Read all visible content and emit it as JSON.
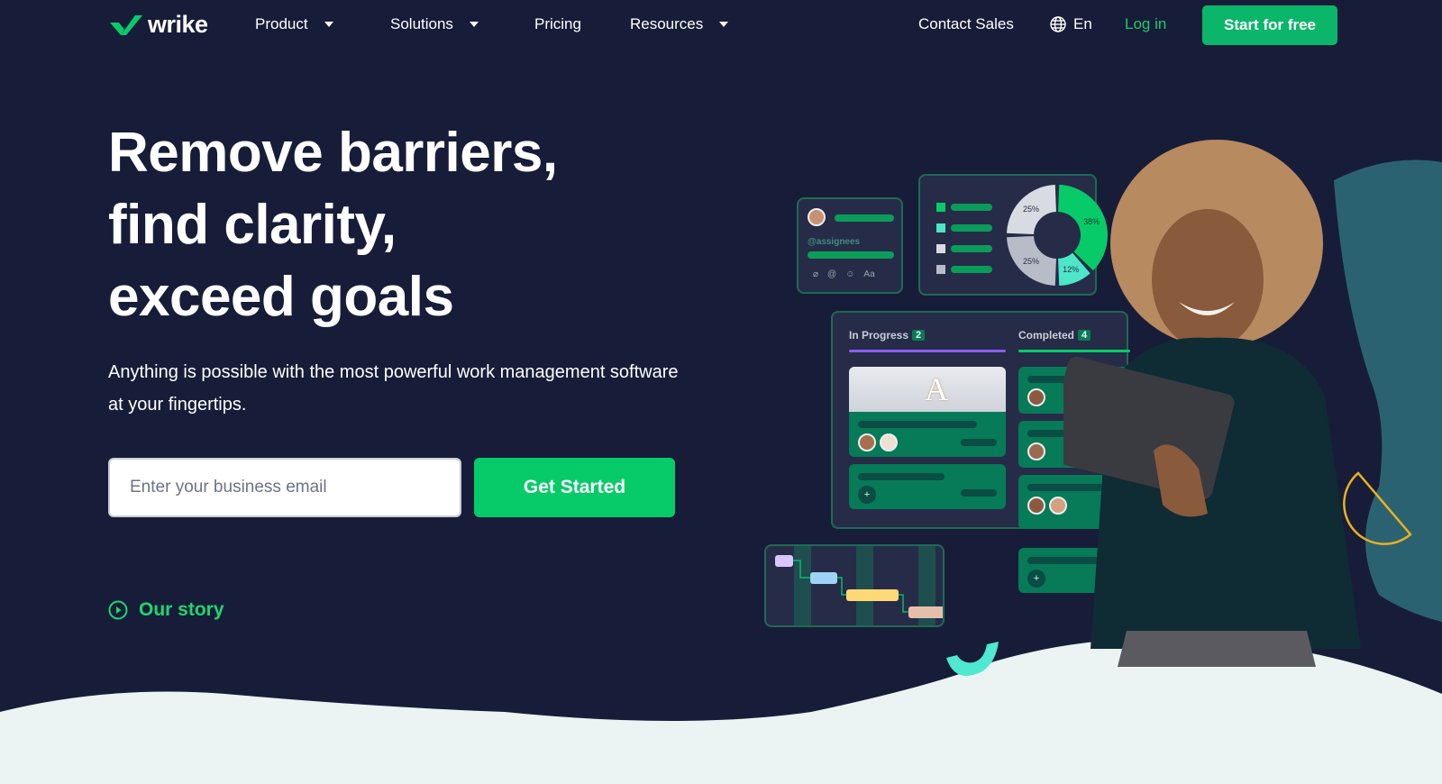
{
  "brand": {
    "name": "wrike",
    "accent": "#07cb69",
    "background": "#171d38"
  },
  "nav": {
    "items": [
      {
        "label": "Product",
        "has_dropdown": true
      },
      {
        "label": "Solutions",
        "has_dropdown": true
      },
      {
        "label": "Pricing",
        "has_dropdown": false
      },
      {
        "label": "Resources",
        "has_dropdown": true
      }
    ],
    "contact_sales": "Contact Sales",
    "language": "En",
    "login": "Log in",
    "cta": "Start for free"
  },
  "hero": {
    "headline_lines": [
      "Remove barriers,",
      "find clarity,",
      "exceed goals"
    ],
    "subtitle": "Anything is possible with the most powerful work management software at your fingertips.",
    "email_placeholder": "Enter your business email",
    "email_value": "",
    "cta": "Get Started",
    "story_link": "Our story"
  },
  "illustration": {
    "comment_card": {
      "mention": "@assignees",
      "toolbar_icons": [
        "paperclip-icon",
        "at-icon",
        "emoji-icon",
        "text-format-icon"
      ],
      "toolbar_text": "Aa"
    },
    "donut": {
      "segments": [
        {
          "label": "38%",
          "value": 38,
          "color": "#07cb69"
        },
        {
          "label": "12%",
          "value": 12,
          "color": "#4de6c9"
        },
        {
          "label": "25%",
          "value": 25,
          "color": "#b8bcc8"
        },
        {
          "label": "25%",
          "value": 25,
          "color": "#d8dbe2"
        }
      ]
    },
    "kanban": {
      "columns": [
        {
          "title": "In Progress",
          "count": "2",
          "color": "#8b5cf6"
        },
        {
          "title": "Completed",
          "count": "4",
          "color": "#07cb69"
        }
      ]
    }
  }
}
